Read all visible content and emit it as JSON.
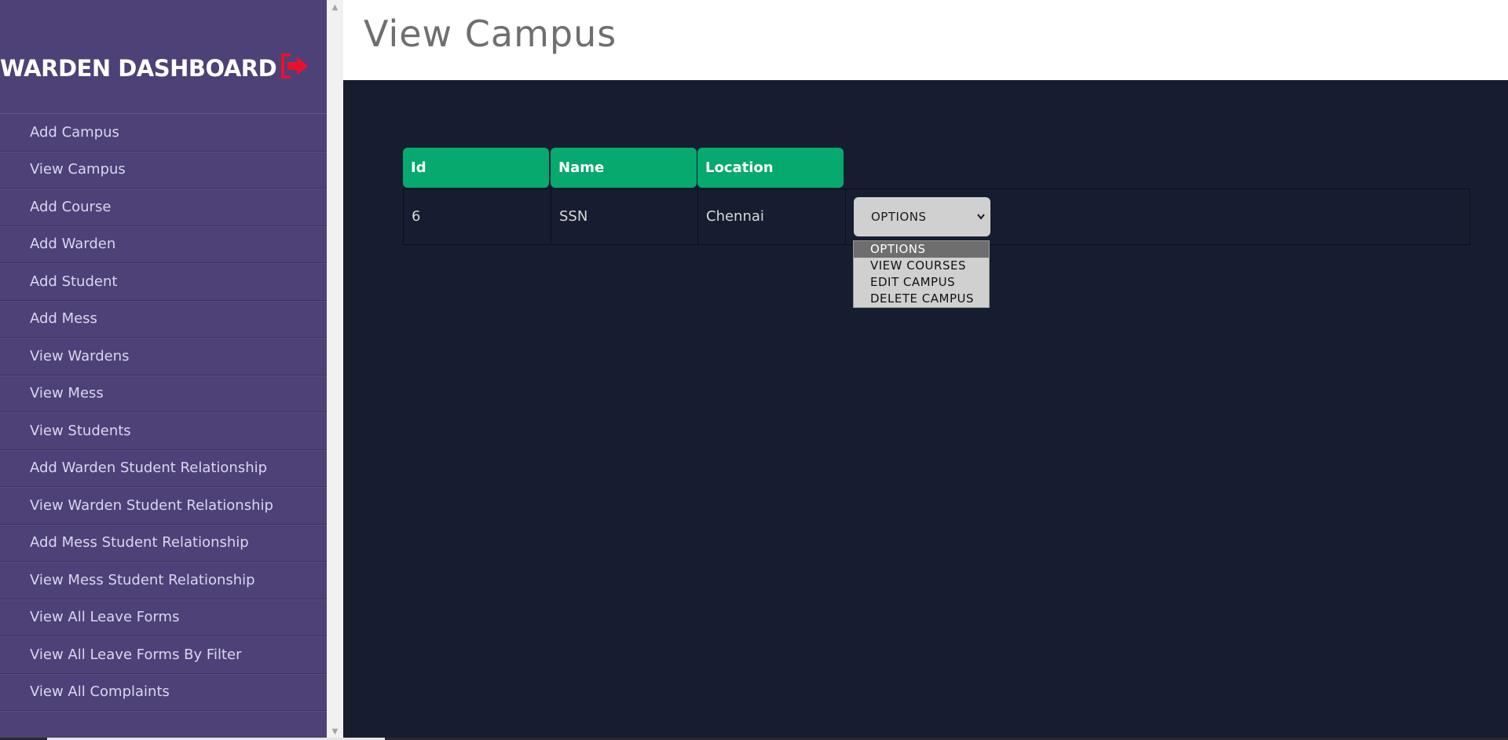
{
  "sidebar": {
    "title": "WARDEN DASHBOARD",
    "logout_icon": "sign-out-icon",
    "logout_color": "#e8112d",
    "items": [
      {
        "label": "Add Campus"
      },
      {
        "label": "View Campus"
      },
      {
        "label": "Add Course"
      },
      {
        "label": "Add Warden"
      },
      {
        "label": "Add Student"
      },
      {
        "label": "Add Mess"
      },
      {
        "label": "View Wardens"
      },
      {
        "label": "View Mess"
      },
      {
        "label": "View Students"
      },
      {
        "label": "Add Warden Student Relationship"
      },
      {
        "label": "View Warden Student Relationship"
      },
      {
        "label": "Add Mess Student Relationship"
      },
      {
        "label": "View Mess Student Relationship"
      },
      {
        "label": "View All Leave Forms"
      },
      {
        "label": "View All Leave Forms By Filter"
      },
      {
        "label": "View All Complaints"
      }
    ]
  },
  "main": {
    "title": "View Campus",
    "table": {
      "headers": [
        "Id",
        "Name",
        "Location"
      ],
      "rows": [
        {
          "id": "6",
          "name": "SSN",
          "location": "Chennai",
          "action": "OPTIONS"
        }
      ]
    },
    "dropdown": {
      "selected": "OPTIONS",
      "options": [
        "OPTIONS",
        "VIEW COURSES",
        "EDIT CAMPUS",
        "DELETE CAMPUS"
      ]
    }
  },
  "colors": {
    "sidebar_bg": "#4d4178",
    "header_green": "#06a96e",
    "content_bg": "#161d31"
  }
}
